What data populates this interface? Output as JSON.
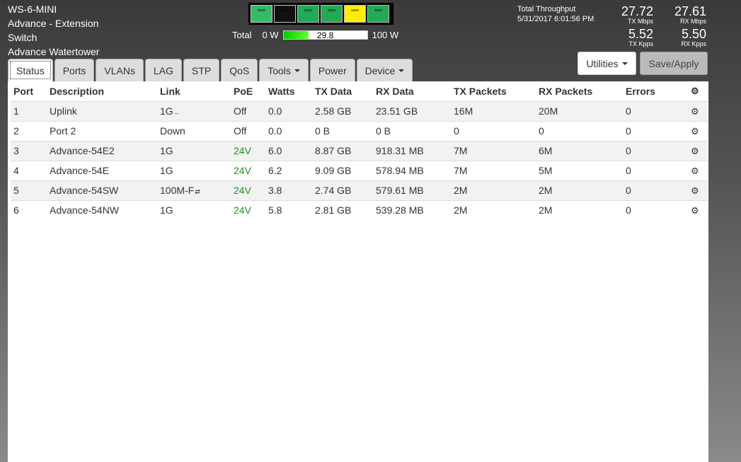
{
  "device": {
    "model": "WS-6-MINI",
    "name": "Advance - Extension",
    "type": "Switch",
    "location": "Advance Watertower"
  },
  "ports_strip": [
    {
      "state": "up"
    },
    {
      "state": "down"
    },
    {
      "state": "up"
    },
    {
      "state": "up"
    },
    {
      "state": "poe"
    },
    {
      "state": "up"
    }
  ],
  "power": {
    "label": "Total",
    "min": "0 W",
    "value": "29.8",
    "max": "100 W",
    "fill_fraction": 0.298
  },
  "throughput": {
    "title": "Total Throughput",
    "timestamp": "5/31/2017 6:01:56 PM",
    "tx_mbps": "27.72",
    "tx_mbps_label": "TX Mbps",
    "rx_mbps": "27.61",
    "rx_mbps_label": "RX Mbps",
    "tx_kpps": "5.52",
    "tx_kpps_label": "TX Kpps",
    "rx_kpps": "5.50",
    "rx_kpps_label": "RX Kpps"
  },
  "buttons": {
    "utilities": "Utilities",
    "save_apply": "Save/Apply"
  },
  "tabs": [
    {
      "label": "Status",
      "dropdown": false
    },
    {
      "label": "Ports",
      "dropdown": false
    },
    {
      "label": "VLANs",
      "dropdown": false
    },
    {
      "label": "LAG",
      "dropdown": false
    },
    {
      "label": "STP",
      "dropdown": false
    },
    {
      "label": "QoS",
      "dropdown": false
    },
    {
      "label": "Tools",
      "dropdown": true
    },
    {
      "label": "Power",
      "dropdown": false
    },
    {
      "label": "Device",
      "dropdown": true
    }
  ],
  "table": {
    "headers": [
      "Port",
      "Description",
      "Link",
      "PoE",
      "Watts",
      "TX Data",
      "RX Data",
      "TX Packets",
      "RX Packets",
      "Errors"
    ],
    "rows": [
      {
        "port": "1",
        "description": "Uplink",
        "link": "1G",
        "link_icon": "←",
        "poe": "Off",
        "watts": "0.0",
        "tx_data": "2.58 GB",
        "rx_data": "23.51 GB",
        "tx_packets": "16M",
        "rx_packets": "20M",
        "errors": "0"
      },
      {
        "port": "2",
        "description": "Port 2",
        "link": "Down",
        "link_icon": "",
        "poe": "Off",
        "watts": "0.0",
        "tx_data": "0 B",
        "rx_data": "0 B",
        "tx_packets": "0",
        "rx_packets": "0",
        "errors": "0"
      },
      {
        "port": "3",
        "description": "Advance-54E2",
        "link": "1G",
        "link_icon": "",
        "poe": "24V",
        "watts": "6.0",
        "tx_data": "8.87 GB",
        "rx_data": "918.31 MB",
        "tx_packets": "7M",
        "rx_packets": "6M",
        "errors": "0"
      },
      {
        "port": "4",
        "description": "Advance-54E",
        "link": "1G",
        "link_icon": "",
        "poe": "24V",
        "watts": "6.2",
        "tx_data": "9.09 GB",
        "rx_data": "578.94 MB",
        "tx_packets": "7M",
        "rx_packets": "5M",
        "errors": "0"
      },
      {
        "port": "5",
        "description": "Advance-54SW",
        "link": "100M-F",
        "link_icon": "⇄",
        "poe": "24V",
        "watts": "3.8",
        "tx_data": "2.74 GB",
        "rx_data": "579.61 MB",
        "tx_packets": "2M",
        "rx_packets": "2M",
        "errors": "0"
      },
      {
        "port": "6",
        "description": "Advance-54NW",
        "link": "1G",
        "link_icon": "",
        "poe": "24V",
        "watts": "5.8",
        "tx_data": "2.81 GB",
        "rx_data": "539.28 MB",
        "tx_packets": "2M",
        "rx_packets": "2M",
        "errors": "0"
      }
    ]
  },
  "colors": {
    "poe_on": "#228b22",
    "port_up": "#22aa55",
    "port_poe": "#ffee00"
  }
}
